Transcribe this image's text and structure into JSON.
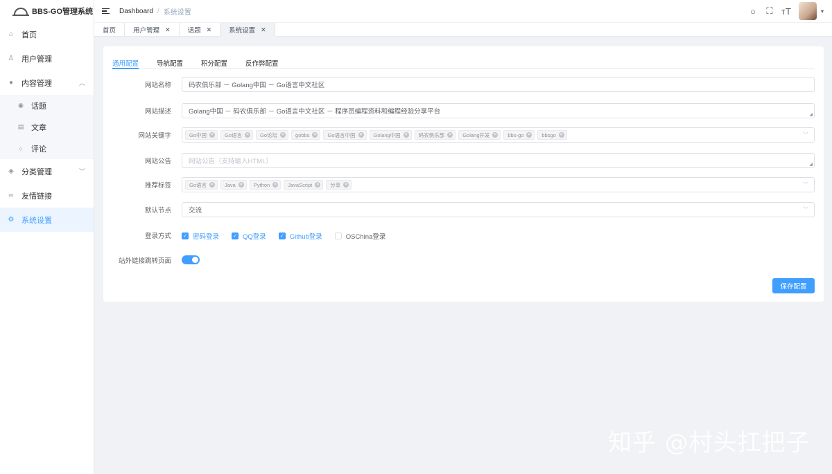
{
  "app": {
    "title": "BBS-GO管理系统"
  },
  "sidebar": {
    "items": [
      {
        "label": "首页",
        "icon": "home-icon"
      },
      {
        "label": "用户管理",
        "icon": "user-icon"
      },
      {
        "label": "内容管理",
        "icon": "content-icon"
      },
      {
        "label": "分类管理",
        "icon": "category-icon"
      },
      {
        "label": "友情链接",
        "icon": "link-icon"
      },
      {
        "label": "系统设置",
        "icon": "settings-icon"
      }
    ],
    "content_sub": [
      {
        "label": "话题",
        "icon": "topic-icon"
      },
      {
        "label": "文章",
        "icon": "article-icon"
      },
      {
        "label": "评论",
        "icon": "comment-icon"
      }
    ]
  },
  "header": {
    "breadcrumb_root": "Dashboard",
    "breadcrumb_sep": "/",
    "breadcrumb_current": "系统设置"
  },
  "tags_view": [
    {
      "label": "首页",
      "closable": false
    },
    {
      "label": "用户管理",
      "closable": true
    },
    {
      "label": "话题",
      "closable": true
    },
    {
      "label": "系统设置",
      "closable": true,
      "active": true
    }
  ],
  "settings": {
    "tabs": [
      "通用配置",
      "导航配置",
      "积分配置",
      "反作弊配置"
    ],
    "active_tab": "通用配置",
    "site_name_label": "网站名称",
    "site_name_value": "码农俱乐部 － Golang中国 － Go语言中文社区",
    "site_desc_label": "网站描述",
    "site_desc_value": "Golang中国 － 码农俱乐部 － Go语言中文社区 － 程序员编程资料和编程经验分享平台",
    "keywords_label": "网站关键字",
    "keywords": [
      "Go中国",
      "Go语言",
      "Go论坛",
      "gobbs",
      "Go语言中国",
      "Golang中国",
      "码农俱乐部",
      "Golang开发",
      "bbs-go",
      "bbsgo"
    ],
    "notice_label": "网站公告",
    "notice_placeholder": "网站公告（支持输入HTML）",
    "recommend_label": "推荐标签",
    "recommend_tags": [
      "Go语言",
      "Java",
      "Python",
      "JavaScript",
      "分享"
    ],
    "default_node_label": "默认节点",
    "default_node_value": "交流",
    "login_label": "登录方式",
    "login_methods": [
      {
        "label": "密码登录",
        "checked": true
      },
      {
        "label": "QQ登录",
        "checked": true
      },
      {
        "label": "Github登录",
        "checked": true
      },
      {
        "label": "OSChina登录",
        "checked": false
      }
    ],
    "external_link_label": "站外链接跳转页面",
    "external_link_enabled": true,
    "save_label": "保存配置"
  },
  "watermark": "知乎 @村头扛把子"
}
